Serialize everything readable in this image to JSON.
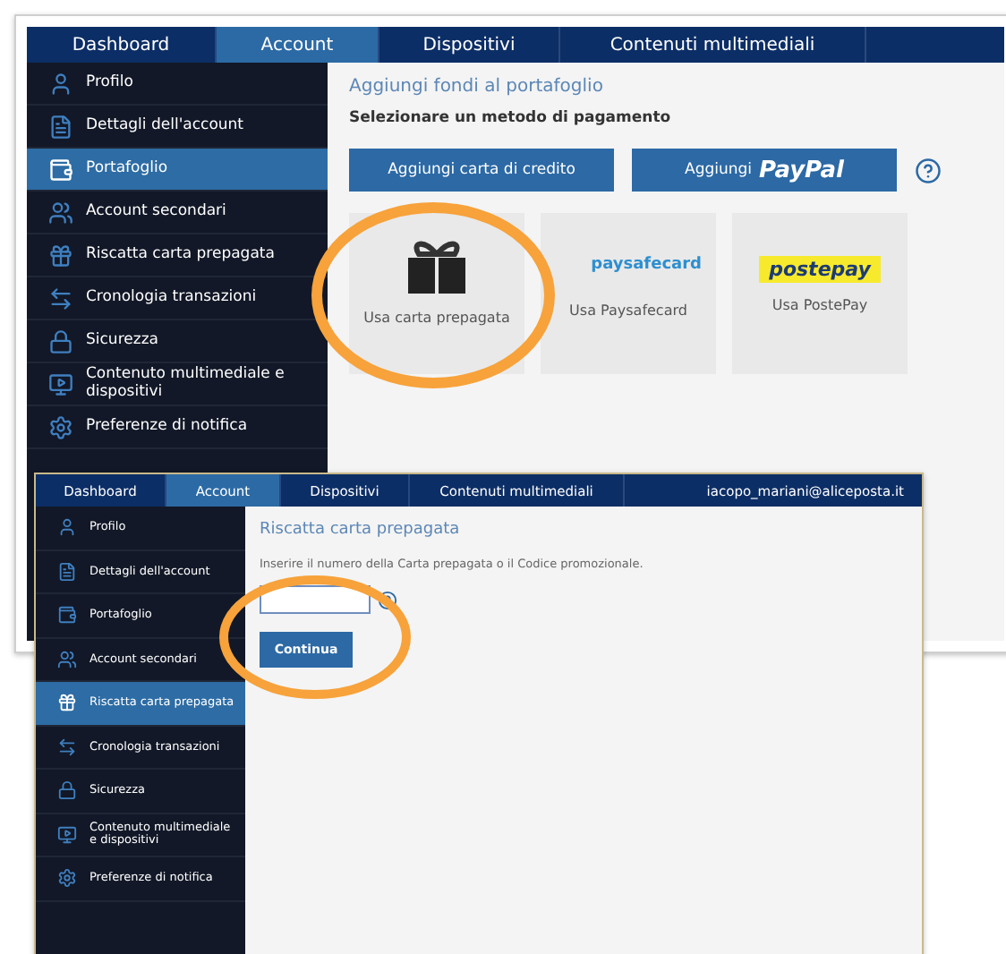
{
  "screenshots": [
    {
      "nav_tabs": [
        {
          "label": "Dashboard",
          "selected": false
        },
        {
          "label": "Account",
          "selected": true
        },
        {
          "label": "Dispositivi",
          "selected": false
        },
        {
          "label": "Contenuti multimediali",
          "selected": false
        }
      ],
      "sidebar": [
        {
          "kind": "profile",
          "label": "Profilo",
          "selected": false
        },
        {
          "kind": "details",
          "label": "Dettagli dell'account",
          "selected": false
        },
        {
          "kind": "wallet",
          "label": "Portafoglio",
          "selected": true
        },
        {
          "kind": "accounts",
          "label": "Account secondari",
          "selected": false
        },
        {
          "kind": "gift",
          "label": "Riscatta carta prepagata",
          "selected": false
        },
        {
          "kind": "history",
          "label": "Cronologia transazioni",
          "selected": false
        },
        {
          "kind": "security",
          "label": "Sicurezza",
          "selected": false
        },
        {
          "kind": "media",
          "label": "Contenuto multimediale e dispositivi",
          "selected": false
        },
        {
          "kind": "notify",
          "label": "Preferenze di notifica",
          "selected": false
        }
      ],
      "title": "Aggiungi fondi al portafoglio",
      "subtitle": "Selezionare un metodo di pagamento",
      "buttons": [
        {
          "label": "Aggiungi carta di credito"
        },
        {
          "label": "Aggiungi",
          "brand": "PayPal"
        }
      ],
      "methods": [
        {
          "kind": "gift",
          "label": "Usa carta prepagata"
        },
        {
          "kind": "paysafecard",
          "logo": "paysafecard",
          "label": "Usa Paysafecard"
        },
        {
          "kind": "postepay",
          "logo": "postepay",
          "label": "Usa PostePay"
        }
      ]
    },
    {
      "nav_tabs": [
        {
          "label": "Dashboard",
          "selected": false
        },
        {
          "label": "Account",
          "selected": true
        },
        {
          "label": "Dispositivi",
          "selected": false
        },
        {
          "label": "Contenuti multimediali",
          "selected": false
        }
      ],
      "user": "iacopo_mariani@aliceposta.it",
      "sidebar": [
        {
          "kind": "profile",
          "label": "Profilo",
          "selected": false
        },
        {
          "kind": "details",
          "label": "Dettagli dell'account",
          "selected": false
        },
        {
          "kind": "wallet",
          "label": "Portafoglio",
          "selected": false
        },
        {
          "kind": "accounts",
          "label": "Account secondari",
          "selected": false
        },
        {
          "kind": "gift",
          "label": "Riscatta carta prepagata",
          "selected": true
        },
        {
          "kind": "history",
          "label": "Cronologia transazioni",
          "selected": false
        },
        {
          "kind": "security",
          "label": "Sicurezza",
          "selected": false
        },
        {
          "kind": "media",
          "label": "Contenuto multimediale e dispositivi",
          "selected": false
        },
        {
          "kind": "notify",
          "label": "Preferenze di notifica",
          "selected": false
        }
      ],
      "title": "Riscatta carta prepagata",
      "instruction": "Inserire il numero della Carta prepagata o il Codice promozionale.",
      "submit": "Continua"
    }
  ]
}
